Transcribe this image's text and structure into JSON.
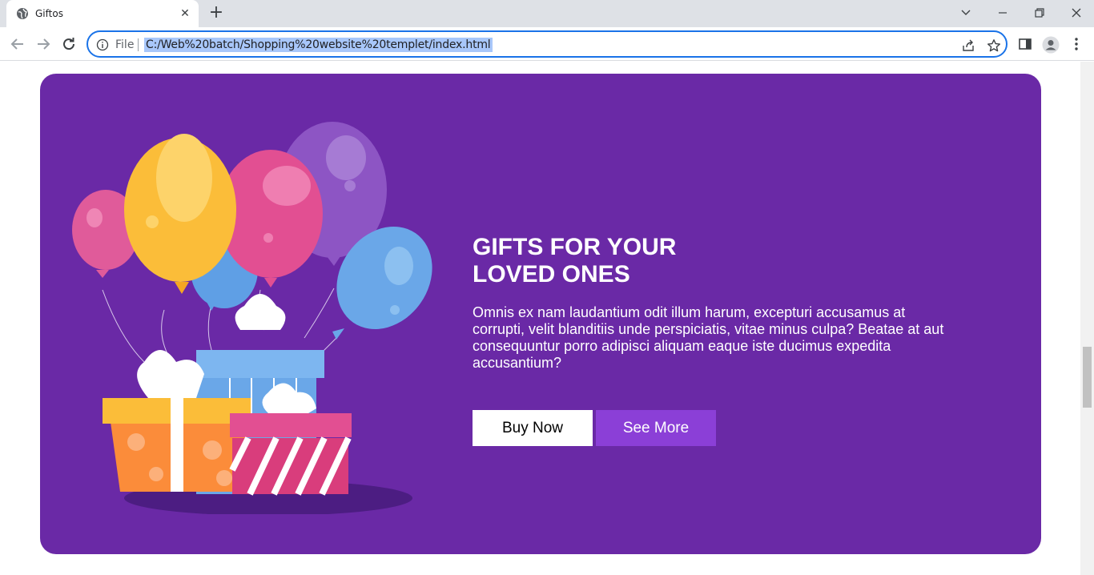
{
  "browser": {
    "tab_title": "Giftos",
    "url_scheme_label": "File",
    "url": "C:/Web%20batch/Shopping%20website%20templet/index.html",
    "tab_close_glyph": "✕",
    "new_tab_glyph": "+"
  },
  "hero": {
    "title_line1": "GIFTS FOR YOUR",
    "title_line2": "LOVED ONES",
    "description": "Omnis ex nam laudantium odit illum harum, excepturi accusamus at corrupti, velit blanditiis unde perspiciatis, vitae minus culpa? Beatae at aut consequuntur porro adipisci aliquam eaque iste ducimus expedita accusantium?",
    "buy_label": "Buy Now",
    "more_label": "See More"
  },
  "colors": {
    "hero_bg": "#6a29a6",
    "secondary_button": "#8b3fd7",
    "omnibox_focus": "#1a73e8"
  },
  "icons": [
    "globe-icon",
    "close-icon",
    "plus-icon",
    "chevron-down-icon",
    "minimize-icon",
    "restore-icon",
    "window-close-icon",
    "back-icon",
    "forward-icon",
    "reload-icon",
    "info-icon",
    "share-icon",
    "star-icon",
    "side-panel-icon",
    "profile-icon",
    "menu-icon"
  ]
}
